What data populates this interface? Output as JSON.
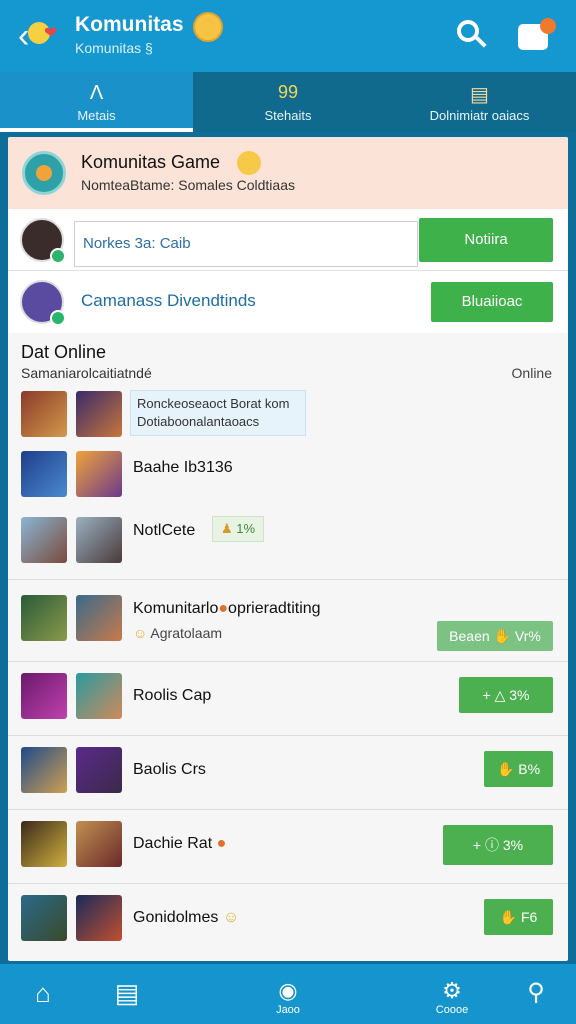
{
  "app": {
    "title": "Komunitas",
    "subtitle": "Komunitas §"
  },
  "tabs": [
    {
      "label": "Metais",
      "icon_name": "triangle-icon",
      "glyph": "Λ"
    },
    {
      "label": "Stehaits",
      "icon_name": "counter-icon",
      "glyph": "99"
    },
    {
      "label": "Dolnimiatr oaiacs",
      "icon_name": "box-icon",
      "glyph": "▤"
    }
  ],
  "header": {
    "title": "Komunitas Game",
    "subtitle": "NomteaBtame: Somales Coldtiaas"
  },
  "search_row": {
    "input_value": "Norkes 3a: Caib",
    "button_label": "Notiira"
  },
  "link_row": {
    "link_label": "Camanass Divendtinds",
    "button_label": "Bluaiioac"
  },
  "section": {
    "title": "Dat Online",
    "subtitle": "Samaniarolcaitiatndé",
    "status": "Online"
  },
  "online_items": [
    {
      "tag_line1": "Ronckeoseaoct Borat kom",
      "tag_line2": "Dotiaboonalantaoacs"
    },
    {
      "text": "Baahe Ib3136"
    },
    {
      "text": "NotlCete",
      "pill": "1%"
    }
  ],
  "community_rows": [
    {
      "text": "Komunitarlo",
      "text2": "oprieradtiting",
      "sub": "Agratolaam",
      "button": "Beaen",
      "button_value": "Vr%"
    },
    {
      "text": "Roolis Cap",
      "button_value": "3%"
    },
    {
      "text": "Baolis Crs",
      "button_value": "B%"
    },
    {
      "text": "Dachie Rat",
      "button_value": "3%"
    },
    {
      "text": "Gonidolmes",
      "button_value": "F6"
    }
  ],
  "bottom_nav": [
    {
      "label": "",
      "icon_name": "home-icon"
    },
    {
      "label": "",
      "icon_name": "window-icon"
    },
    {
      "label": "Jaoo",
      "icon_name": "chat-icon"
    },
    {
      "label": "Coooe",
      "icon_name": "gear-icon"
    },
    {
      "label": "",
      "icon_name": "search-icon"
    }
  ],
  "colors": {
    "topbar": "#1597cf",
    "tabs": "#0f6a8e",
    "accent_green": "#3fb14a",
    "header_bg": "#fbe4d7"
  }
}
